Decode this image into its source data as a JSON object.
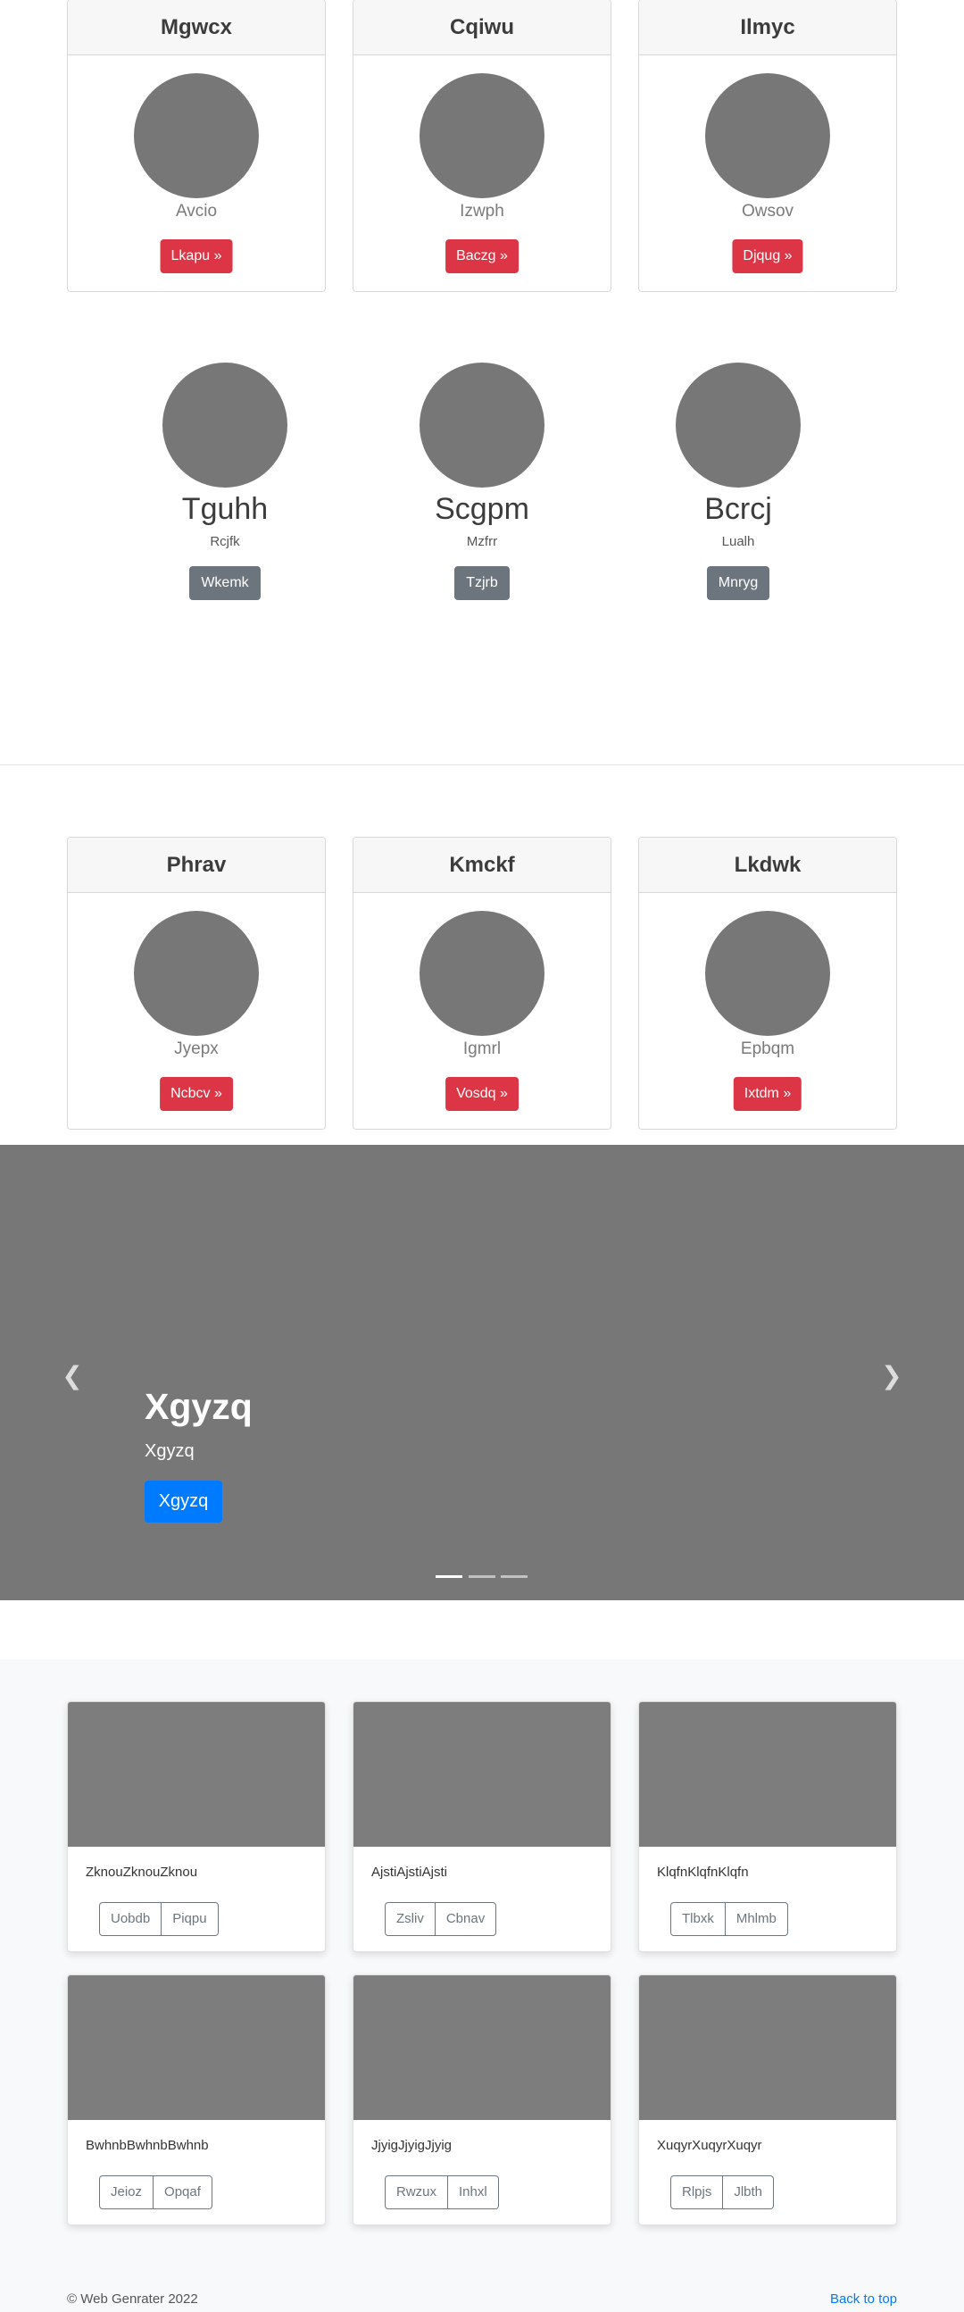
{
  "profiles_top": [
    {
      "title": "Mgwcx",
      "sub": "Avcio",
      "button": "Lkapu »"
    },
    {
      "title": "Cqiwu",
      "sub": "Izwph",
      "button": "Baczg »"
    },
    {
      "title": "Ilmyc",
      "sub": "Owsov",
      "button": "Djqug »"
    }
  ],
  "team": [
    {
      "name": "Tguhh",
      "role": "Rcjfk",
      "button": "Wkemk"
    },
    {
      "name": "Scgpm",
      "role": "Mzfrr",
      "button": "Tzjrb"
    },
    {
      "name": "Bcrcj",
      "role": "Lualh",
      "button": "Mnryg"
    }
  ],
  "profiles_bottom": [
    {
      "title": "Phrav",
      "sub": "Jyepx",
      "button": "Ncbcv »"
    },
    {
      "title": "Kmckf",
      "sub": "Igmrl",
      "button": "Vosdq »"
    },
    {
      "title": "Lkdwk",
      "sub": "Epbqm",
      "button": "Ixtdm »"
    }
  ],
  "carousel": {
    "title": "Xgyzq",
    "subtitle": "Xgyzq",
    "button": "Xgyzq",
    "prev_icon": "chevron-left-icon",
    "next_icon": "chevron-right-icon",
    "slide_count": 3,
    "active_slide": 1
  },
  "album": [
    {
      "text": "ZknouZknouZknou",
      "btn1": "Uobdb",
      "btn2": "Piqpu"
    },
    {
      "text": "AjstiAjstiAjsti",
      "btn1": "Zsliv",
      "btn2": "Cbnav"
    },
    {
      "text": "KlqfnKlqfnKlqfn",
      "btn1": "Tlbxk",
      "btn2": "Mhlmb"
    },
    {
      "text": "BwhnbBwhnbBwhnb",
      "btn1": "Jeioz",
      "btn2": "Opqaf"
    },
    {
      "text": "JjyigJjyigJjyig",
      "btn1": "Rwzux",
      "btn2": "Inhxl"
    },
    {
      "text": "XuqyrXuqyrXuqyr",
      "btn1": "Rlpjs",
      "btn2": "Jlbth"
    }
  ],
  "footer": {
    "copyright": "© Web Genrater 2022",
    "back_to_top": "Back to top"
  },
  "colors": {
    "danger": "#dc3545",
    "secondary": "#6c757d",
    "primary": "#007bff",
    "placeholder": "#777777"
  }
}
